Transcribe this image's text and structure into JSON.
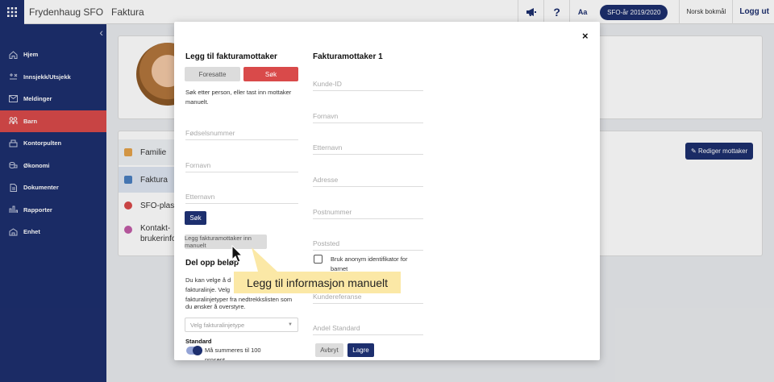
{
  "topbar": {
    "app_title": "Frydenhaug SFO",
    "page_title": "Faktura",
    "font_toggle": "Aa",
    "year_pill": "SFO-år 2019/2020",
    "language": "Norsk bokmål",
    "logout": "Logg ut",
    "icons": [
      "apps-grid-icon",
      "megaphone-icon",
      "help-icon"
    ]
  },
  "sidebar": {
    "items": [
      {
        "label": "Hjem",
        "icon": "home-icon"
      },
      {
        "label": "Innsjekk/Utsjekk",
        "icon": "check-in-out-icon"
      },
      {
        "label": "Meldinger",
        "icon": "mail-icon"
      },
      {
        "label": "Barn",
        "icon": "children-icon",
        "active": true
      },
      {
        "label": "Kontorpulten",
        "icon": "desk-icon"
      },
      {
        "label": "Økonomi",
        "icon": "coins-icon"
      },
      {
        "label": "Dokumenter",
        "icon": "document-icon"
      },
      {
        "label": "Rapporter",
        "icon": "chart-icon"
      },
      {
        "label": "Enhet",
        "icon": "building-icon"
      }
    ]
  },
  "background": {
    "tabs": [
      {
        "label": "Familie"
      },
      {
        "label": "Faktura"
      },
      {
        "label": "SFO-plas"
      },
      {
        "label": "Kontakt-"
      },
      {
        "label": "brukerinfo"
      }
    ],
    "edit_button": "Rediger mottaker"
  },
  "modal": {
    "left": {
      "title": "Legg til fakturamottaker",
      "btn_foresatte": "Foresatte",
      "btn_sok": "Søk",
      "help": "Søk etter person, eller tast inn mottaker manuelt.",
      "fodselsnummer_placeholder": "Fødselsnummer",
      "fornavn_placeholder": "Fornavn",
      "etternavn_placeholder": "Etternavn",
      "search_button": "Søk",
      "manual_button": "Legg fakturamottaker inn manuelt",
      "split_title": "Del opp beløp",
      "split_text_1": "Du kan velge å d",
      "split_text_2": "fakturalinje. Velg",
      "split_text_3": "fakturalinjetyper fra nedtrekkslisten som",
      "split_text_4": "du ønsker å overstyre.",
      "select_placeholder": "Velg fakturalinjetype",
      "standard_label": "Standard",
      "toggle_label": "Må summeres til 100",
      "toggle_label_2": "prosent"
    },
    "right": {
      "title": "Fakturamottaker 1",
      "fields": [
        "Kunde-ID",
        "Fornavn",
        "Etternavn",
        "Adresse",
        "Postnummer",
        "Poststed"
      ],
      "checkbox_label_1": "Bruk anonym identifikator for",
      "checkbox_label_2": "barnet",
      "kundereferanse_placeholder": "Kundereferanse",
      "andel_placeholder": "Andel Standard",
      "cancel_button": "Avbryt",
      "save_button": "Lagre"
    },
    "close_icon": "×"
  },
  "callout": {
    "text": "Legg til informasjon manuelt"
  }
}
